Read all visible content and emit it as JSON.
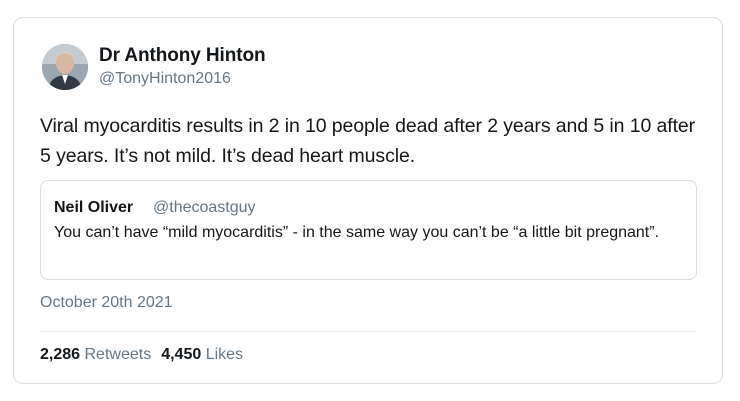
{
  "author": {
    "name": "Dr Anthony Hinton",
    "handle": "@TonyHinton2016"
  },
  "tweet": {
    "text": "Viral myocarditis results in 2 in 10 people dead after 2 years and 5 in 10 after 5 years. It’s not mild. It’s dead heart muscle.",
    "date": "October 20th 2021"
  },
  "quoted": {
    "name": "Neil Oliver",
    "handle": "@thecoastguy",
    "text": "You can’t have “mild myocarditis” - in the same way you can’t be “a little bit pregnant”."
  },
  "stats": {
    "retweets_count": "2,286",
    "retweets_label": "Retweets",
    "likes_count": "4,450",
    "likes_label": "Likes"
  },
  "colors": {
    "text": "#14171a",
    "secondary": "#657786",
    "border": "#d9dfe3"
  }
}
